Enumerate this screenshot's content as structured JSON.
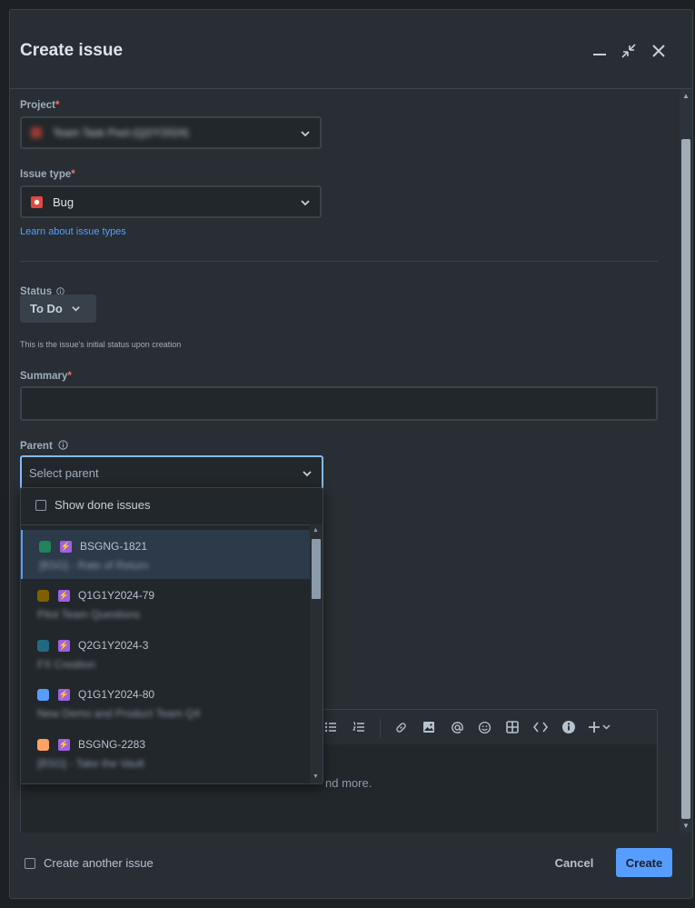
{
  "modal": {
    "title": "Create issue"
  },
  "form": {
    "project": {
      "label": "Project",
      "required_mark": "*",
      "value": "Team Task Pool (Q2/Y2024)"
    },
    "issue_type": {
      "label": "Issue type",
      "required_mark": "*",
      "value": "Bug",
      "help_link": "Learn about issue types"
    },
    "status": {
      "label": "Status",
      "value": "To Do",
      "help": "This is the issue's initial status upon creation"
    },
    "summary": {
      "label": "Summary",
      "required_mark": "*",
      "value": ""
    },
    "parent": {
      "label": "Parent",
      "placeholder": "Select parent"
    },
    "description": {
      "placeholder_tail": "nd more."
    }
  },
  "parent_dropdown": {
    "show_done_label": "Show done issues",
    "items": [
      {
        "key": "BSGNG-1821",
        "summary": "[BSG] - Rate of Return",
        "color": "#1f845a"
      },
      {
        "key": "Q1G1Y2024-79",
        "summary": "Pilot Team Questions",
        "color": "#7f5f01"
      },
      {
        "key": "Q2G1Y2024-3",
        "summary": "FX Creation",
        "color": "#206a83"
      },
      {
        "key": "Q1G1Y2024-80",
        "summary": "New Demo and Product Team Q4",
        "color": "#579dff"
      },
      {
        "key": "BSGNG-2283",
        "summary": "[BSG] - Take the Vault",
        "color": "#fea362"
      }
    ]
  },
  "footer": {
    "create_another_label": "Create another issue",
    "cancel_label": "Cancel",
    "create_label": "Create"
  },
  "icons": {
    "minimize": "minimize-icon",
    "collapse": "collapse-icon",
    "close": "close-icon",
    "chevron": "chevron-down-icon",
    "bug": "bug-icon",
    "info": "info-icon",
    "epic": "lightning-icon"
  },
  "colors": {
    "accent": "#579dff",
    "bug": "#e2483d",
    "epic": "#9f60e0"
  }
}
